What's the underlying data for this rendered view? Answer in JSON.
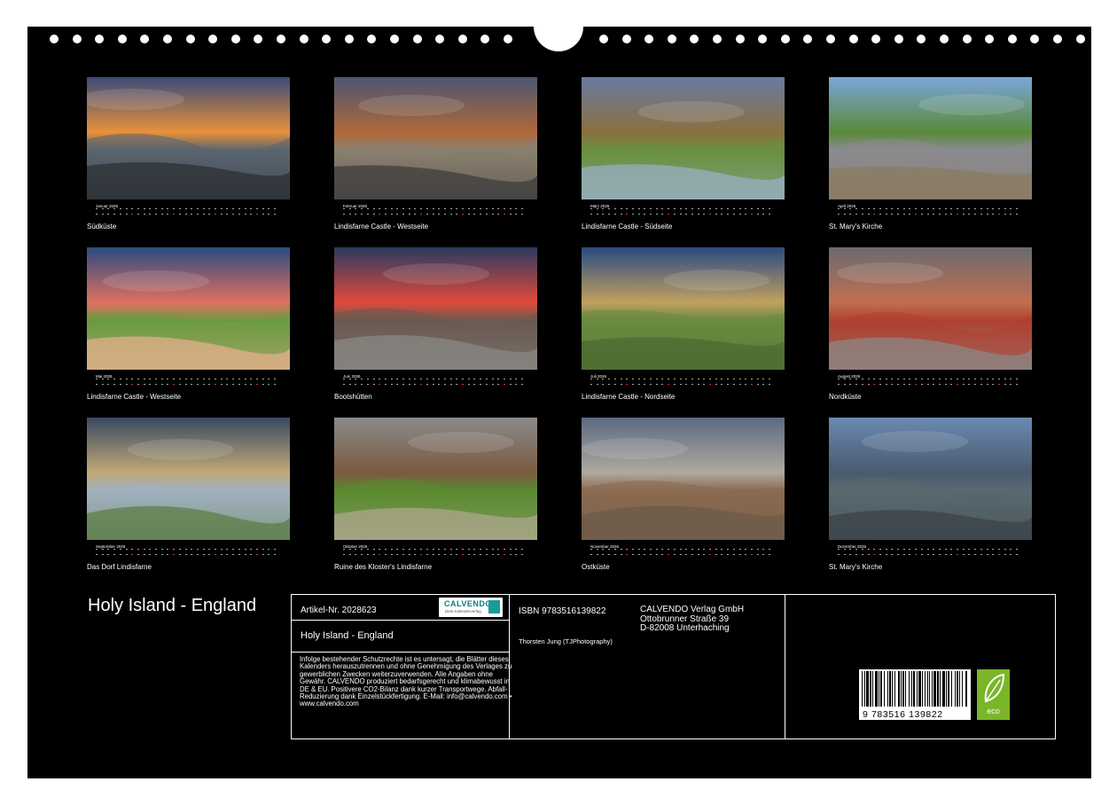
{
  "months": [
    {
      "month": "Januar 2026",
      "caption": "Südküste",
      "palette": [
        "#3a4a78",
        "#e8913a",
        "#5a6470",
        "#2a2e30"
      ]
    },
    {
      "month": "Februar 2026",
      "caption": "Lindisfarne Castle - Westseite",
      "palette": [
        "#4a5670",
        "#b0683a",
        "#8a8070",
        "#3a3a3a"
      ]
    },
    {
      "month": "März 2026",
      "caption": "Lindisfarne Castle - Südseite",
      "palette": [
        "#6a7aa0",
        "#8a7040",
        "#6a9040",
        "#9ab0c8"
      ]
    },
    {
      "month": "April 2026",
      "caption": "St. Mary's Kirche",
      "palette": [
        "#7aa6d8",
        "#5a8a3a",
        "#8a8a90",
        "#8a7a60"
      ]
    },
    {
      "month": "Mai 2026",
      "caption": "Lindisfarne Castle - Westseite",
      "palette": [
        "#2a4a80",
        "#e07060",
        "#6a9a40",
        "#e8b090"
      ]
    },
    {
      "month": "Juni 2026",
      "caption": "Bootshütten",
      "palette": [
        "#2a3a60",
        "#e04a3a",
        "#6a5a50",
        "#8a8a88"
      ]
    },
    {
      "month": "Juli 2026",
      "caption": "Lindisfarne Castle - Nordseite",
      "palette": [
        "#2a4a80",
        "#c0a060",
        "#6a8a40",
        "#4a6a30"
      ]
    },
    {
      "month": "August 2026",
      "caption": "Nordküste",
      "palette": [
        "#6a6a70",
        "#c07050",
        "#b04030",
        "#8a8a88"
      ]
    },
    {
      "month": "September 2026",
      "caption": "Das Dorf Lindisfarne",
      "palette": [
        "#3a4a60",
        "#c0a878",
        "#a0b0c0",
        "#5a7a40"
      ]
    },
    {
      "month": "Oktober 2026",
      "caption": "Ruine des Kloster's Lindisfarne",
      "palette": [
        "#8a8a8a",
        "#7a5a40",
        "#5a8a30",
        "#b0a890"
      ]
    },
    {
      "month": "November 2026",
      "caption": "Ostküste",
      "palette": [
        "#5a6a80",
        "#b0a8a0",
        "#8a6a50",
        "#6a5a48"
      ]
    },
    {
      "month": "Dezember 2026",
      "caption": "St. Mary's Kirche",
      "palette": [
        "#6a8ab0",
        "#4a5a70",
        "#5a6a70",
        "#3a4048"
      ]
    }
  ],
  "title": "Holy Island - England",
  "info": {
    "article": "Artikel-Nr. 2028623",
    "subtitle": "Holy Island - England",
    "legal": "Infolge bestehender Schutzrechte ist es untersagt, die Blätter dieses Kalenders herauszutrennen und ohne Genehmigung des Verlages zu gewerblichen Zwecken weiterzuverwenden. Alle Angaben ohne Gewähr. CALVENDO produziert bedarfsgerecht und klimabewusst in DE & EU. Positivere CO2-Bilanz dank kurzer Transportwege. Abfall-Reduzierung dank Einzelstückfertigung. E-Mail: info@calvendo.com • www.calvendo.com",
    "isbn": "ISBN 9783516139822",
    "author": "Thorsten Jung (TJPhotography)",
    "publisher": [
      "CALVENDO Verlag GmbH",
      "Ottobrunner Straße 39",
      "D-82008 Unterhaching"
    ],
    "logo_text": "CALVENDO",
    "logo_sub": "Dein Kalenderverlag",
    "barcode_number": "9 783516 139822",
    "eco_label": "eco"
  }
}
